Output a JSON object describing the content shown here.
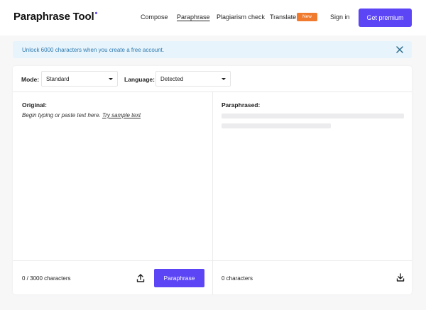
{
  "header": {
    "logo_text": "Paraphrase Tool",
    "logo_dot": "•",
    "nav": [
      {
        "label": "Compose"
      },
      {
        "label": "Paraphrase"
      },
      {
        "label": "Plagiarism check"
      },
      {
        "label": "Translate"
      }
    ],
    "badge_new": "New",
    "sign_in": "Sign in",
    "premium": "Get premium"
  },
  "banner": {
    "text": "Unlock 6000 characters when you create a free account.",
    "close_icon": "close-icon"
  },
  "toolbar": {
    "mode_label": "Mode:",
    "mode_value": "Standard",
    "language_label": "Language:",
    "language_value": "Detected"
  },
  "original": {
    "title": "Original:",
    "placeholder": "Begin typing or paste text here.",
    "try_sample": "Try sample text",
    "count": "0 / 3000 characters",
    "upload_icon": "upload-icon",
    "button": "Paraphrase"
  },
  "paraphrased": {
    "title": "Paraphrased:",
    "count": "0 characters",
    "download_icon": "download-icon"
  },
  "colors": {
    "accent": "#5b45f5",
    "badge": "#f07a2d",
    "banner_bg": "#e8f4fb",
    "banner_text": "#2c7ab0"
  }
}
